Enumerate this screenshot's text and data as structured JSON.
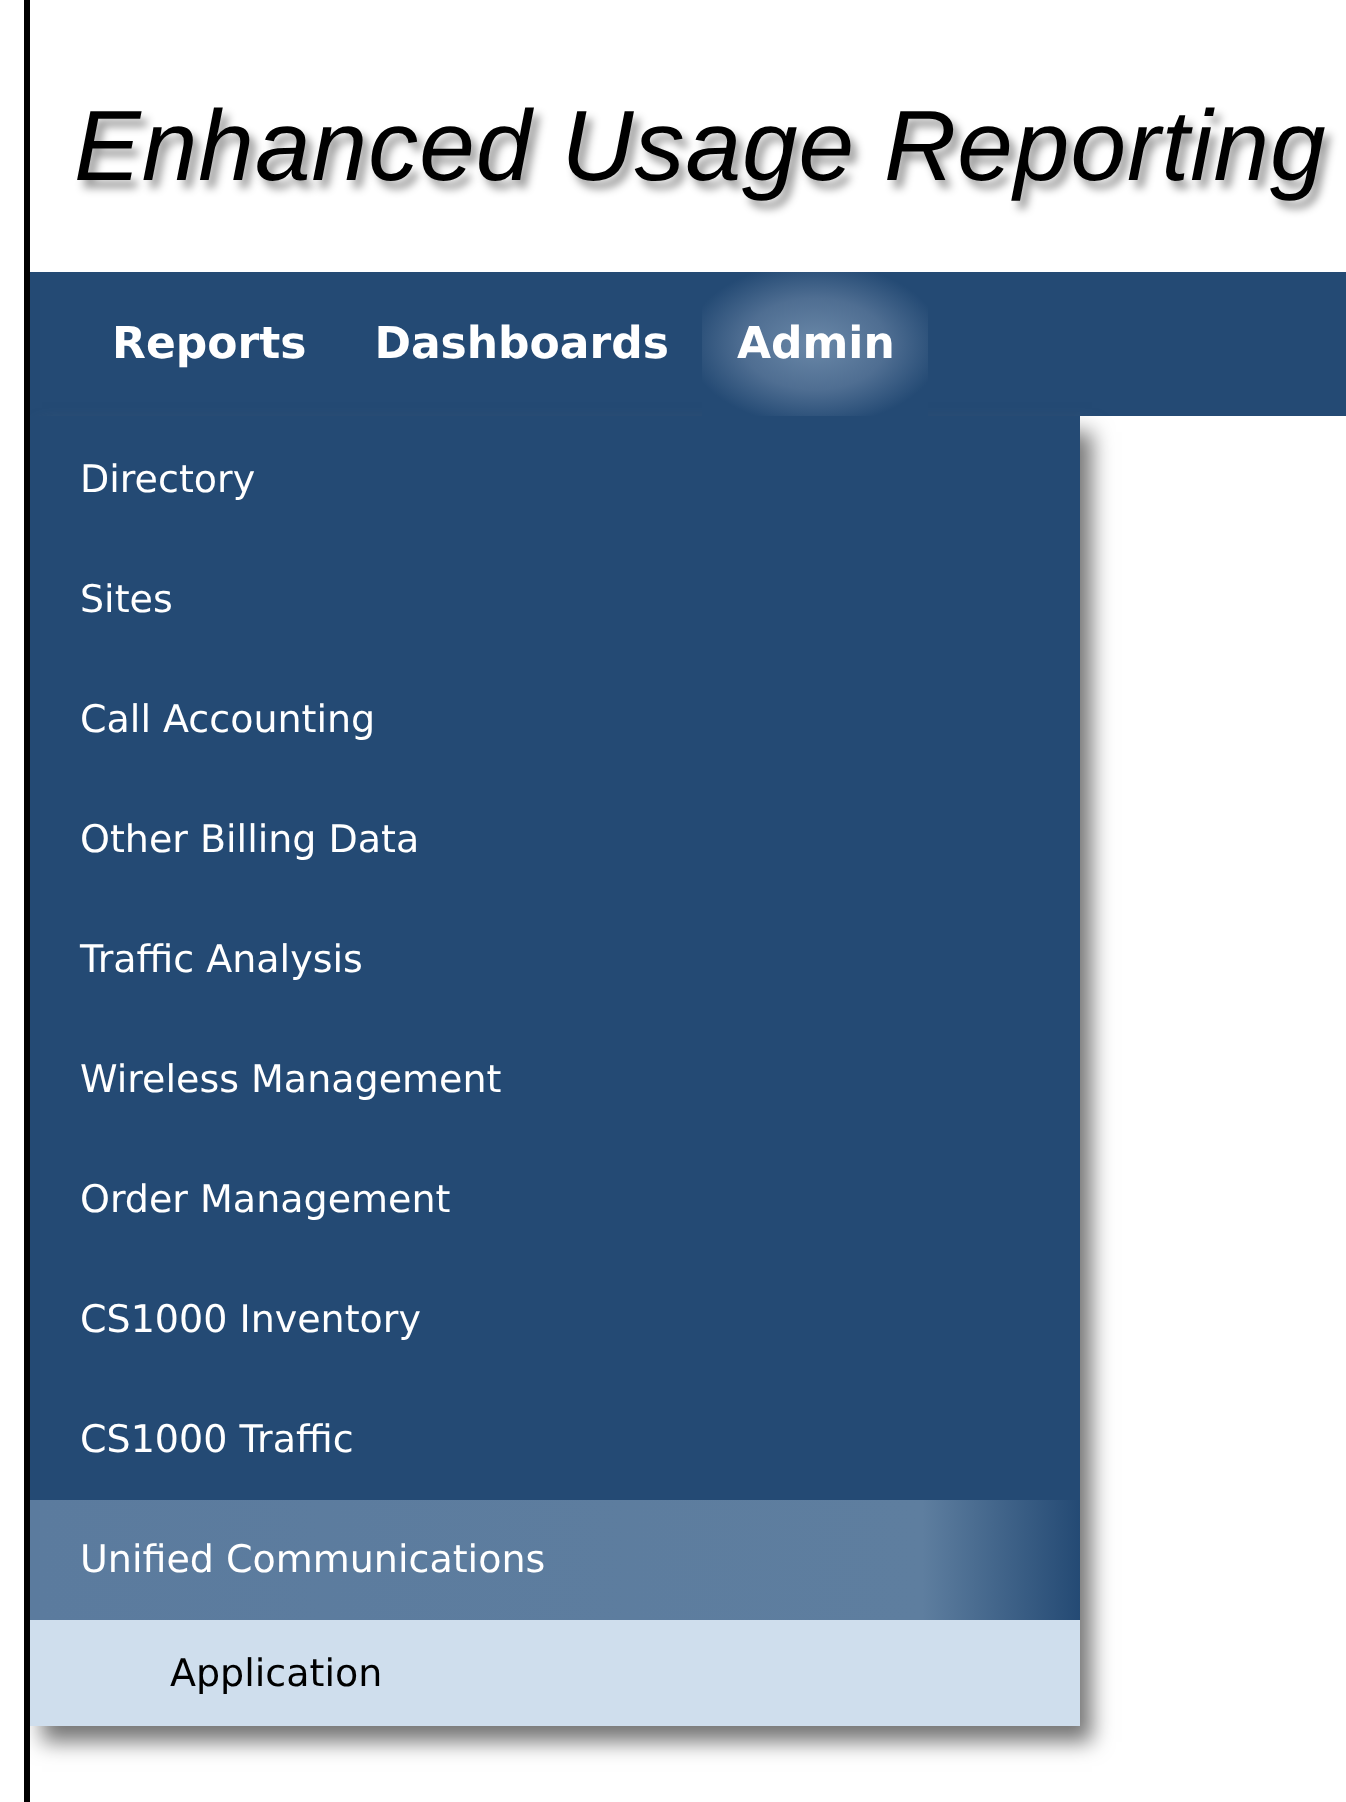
{
  "header": {
    "title": "Enhanced Usage Reporting"
  },
  "nav": [
    {
      "label": "Reports",
      "selected": false
    },
    {
      "label": "Dashboards",
      "selected": false
    },
    {
      "label": "Admin",
      "selected": true
    }
  ],
  "menu": [
    {
      "label": "Directory",
      "selected": false
    },
    {
      "label": "Sites",
      "selected": false
    },
    {
      "label": "Call Accounting",
      "selected": false
    },
    {
      "label": "Other Billing Data",
      "selected": false
    },
    {
      "label": "Traffic Analysis",
      "selected": false
    },
    {
      "label": "Wireless Management",
      "selected": false
    },
    {
      "label": "Order Management",
      "selected": false
    },
    {
      "label": "CS1000 Inventory",
      "selected": false
    },
    {
      "label": "CS1000 Traffic",
      "selected": false
    },
    {
      "label": "Unified Communications",
      "selected": true,
      "children": [
        {
          "label": "Application",
          "selected": false
        }
      ]
    }
  ]
}
